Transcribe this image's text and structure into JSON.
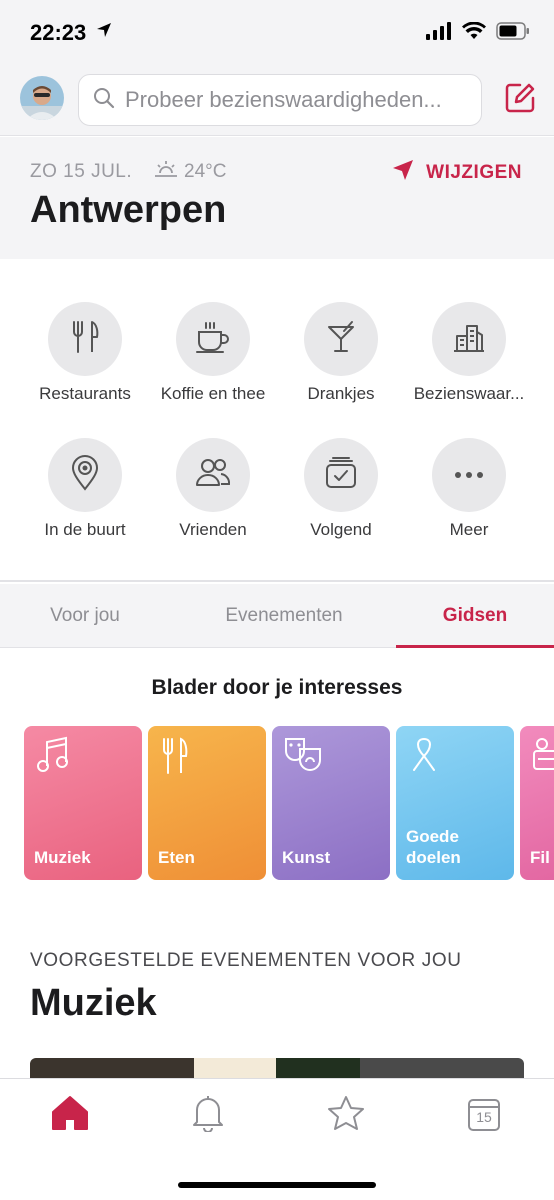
{
  "status_bar": {
    "time": "22:23"
  },
  "header": {
    "search_placeholder": "Probeer bezienswaardigheden..."
  },
  "location": {
    "date": "ZO 15 JUL.",
    "temperature": "24°C",
    "city": "Antwerpen",
    "change_label": "WIJZIGEN"
  },
  "categories": [
    {
      "label": "Restaurants",
      "icon": "fork-knife-icon"
    },
    {
      "label": "Koffie en thee",
      "icon": "coffee-cup-icon"
    },
    {
      "label": "Drankjes",
      "icon": "cocktail-icon"
    },
    {
      "label": "Bezienswaar...",
      "icon": "buildings-icon"
    },
    {
      "label": "In de buurt",
      "icon": "location-pin-icon"
    },
    {
      "label": "Vrienden",
      "icon": "friends-icon"
    },
    {
      "label": "Volgend",
      "icon": "following-icon"
    },
    {
      "label": "Meer",
      "icon": "more-icon"
    }
  ],
  "tabs": [
    {
      "label": "Voor jou",
      "active": false
    },
    {
      "label": "Evenementen",
      "active": false
    },
    {
      "label": "Gidsen",
      "active": true
    }
  ],
  "interests": {
    "title": "Blader door je interesses",
    "cards": [
      {
        "label": "Muziek",
        "icon": "music-note-icon",
        "color": "#ef6f8f"
      },
      {
        "label": "Eten",
        "icon": "fork-knife-icon",
        "color": "#f3a23e"
      },
      {
        "label": "Kunst",
        "icon": "theater-masks-icon",
        "color": "#9b83cf"
      },
      {
        "label": "Goede doelen",
        "icon": "ribbon-icon",
        "color": "#74c6ef"
      },
      {
        "label": "Fil",
        "icon": "film-camera-icon",
        "color": "#e96fa8"
      }
    ]
  },
  "suggested": {
    "eyebrow": "VOORGESTELDE EVENEMENTEN VOOR JOU",
    "title": "Muziek"
  },
  "bottom_nav": [
    {
      "icon": "home-icon",
      "active": true
    },
    {
      "icon": "bell-icon",
      "active": false
    },
    {
      "icon": "star-icon",
      "active": false
    },
    {
      "icon": "calendar-icon",
      "active": false,
      "text": "15"
    }
  ],
  "colors": {
    "accent": "#c8244a",
    "background": "#f4f4f6"
  }
}
